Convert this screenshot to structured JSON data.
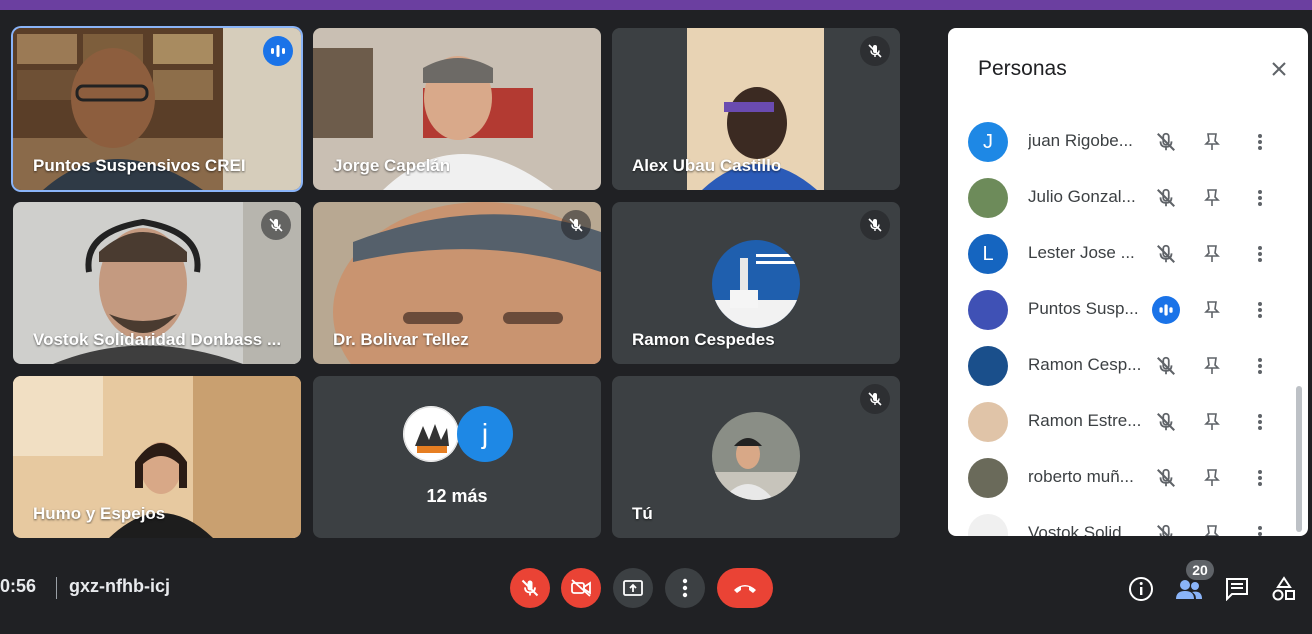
{
  "meeting": {
    "time": "0:56",
    "code": "gxz-nfhb-icj"
  },
  "tiles": [
    {
      "name": "Puntos Suspensivos CREI",
      "state": "speaking"
    },
    {
      "name": "Jorge Capelán",
      "state": "none"
    },
    {
      "name": "Alex Ubau Castillo",
      "state": "muted"
    },
    {
      "name": "Vostok Solidaridad Donbass ...",
      "state": "muted"
    },
    {
      "name": "Dr. Bolivar Tellez",
      "state": "muted"
    },
    {
      "name": "Ramon Cespedes",
      "state": "muted"
    },
    {
      "name": "Humo y Espejos",
      "state": "none"
    },
    {
      "more_label": "12 más",
      "avatar_letter": "j"
    },
    {
      "name": "Tú",
      "state": "muted"
    }
  ],
  "panel": {
    "title": "Personas",
    "participants": [
      {
        "name": "juan Rigobe...",
        "avatar_letter": "J",
        "avatar_color": "#1e88e5",
        "status": "muted"
      },
      {
        "name": "Julio Gonzal...",
        "avatar_letter": "",
        "avatar_color": "#6d8b5a",
        "status": "muted"
      },
      {
        "name": "Lester Jose ...",
        "avatar_letter": "L",
        "avatar_color": "#1565c0",
        "status": "muted"
      },
      {
        "name": "Puntos Susp...",
        "avatar_letter": "",
        "avatar_color": "#3f51b5",
        "status": "speaking"
      },
      {
        "name": "Ramon Cesp...",
        "avatar_letter": "",
        "avatar_color": "#1a4f8b",
        "status": "muted"
      },
      {
        "name": "Ramon Estre...",
        "avatar_letter": "",
        "avatar_color": "#e0c4a8",
        "status": "muted"
      },
      {
        "name": "roberto muñ...",
        "avatar_letter": "",
        "avatar_color": "#6a6a5a",
        "status": "muted"
      },
      {
        "name": "Vostok Solid...",
        "avatar_letter": "",
        "avatar_color": "#f0f0f0",
        "status": "muted"
      }
    ]
  },
  "toolbar": {
    "people_count": "20"
  },
  "colors": {
    "accent": "#8ab4f8",
    "danger": "#ea4335",
    "speaking": "#1a73e8",
    "background": "#202124"
  }
}
